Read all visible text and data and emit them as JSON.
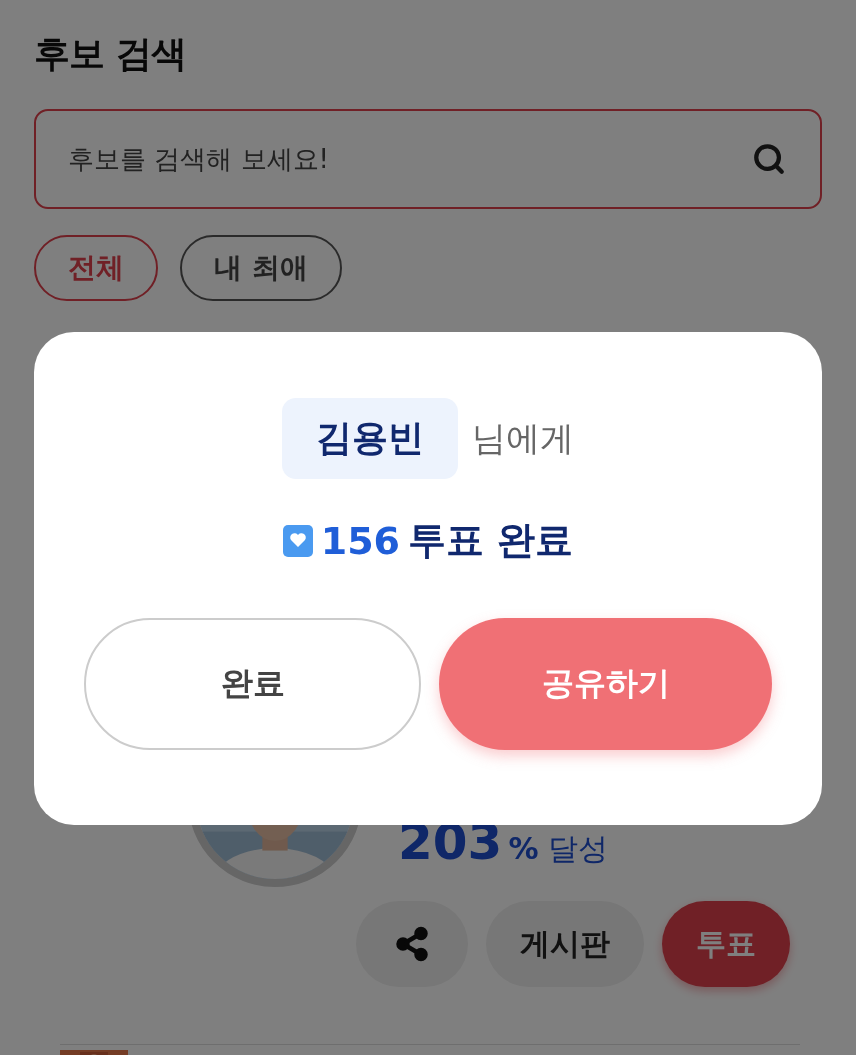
{
  "page": {
    "title": "후보 검색"
  },
  "search": {
    "placeholder": "후보를 검색해 보세요!"
  },
  "filters": [
    {
      "label": "전체",
      "selected": true
    },
    {
      "label": "내 최애",
      "selected": false
    }
  ],
  "candidate": {
    "achievement": {
      "value": "203",
      "unit": "%",
      "label": "달성"
    },
    "actions": [
      {
        "kind": "share"
      },
      {
        "kind": "board",
        "label": "게시판"
      },
      {
        "kind": "vote",
        "label": "투표"
      }
    ]
  },
  "dialog": {
    "name": "김용빈",
    "suffix": "님에게",
    "count": "156",
    "message": "투표 완료",
    "buttons": [
      {
        "kind": "secondary",
        "label": "완료"
      },
      {
        "kind": "primary",
        "label": "공유하기"
      }
    ]
  }
}
